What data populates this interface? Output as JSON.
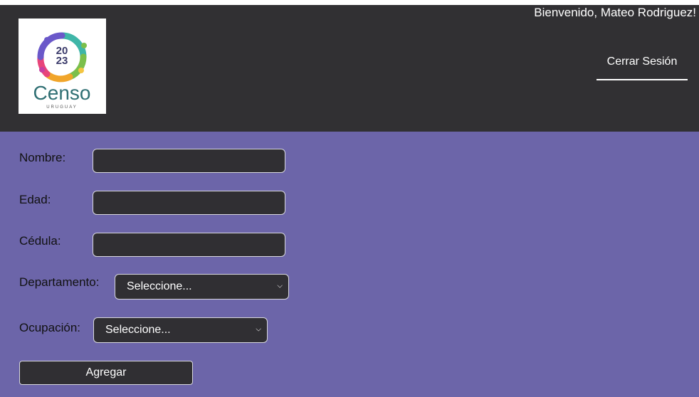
{
  "header": {
    "logo": {
      "year_top": "20",
      "year_bottom": "23",
      "brand": "Censo",
      "country": "URUGUAY"
    },
    "welcome": "Bienvenido, Mateo Rodriguez!",
    "logout_label": "Cerrar Sesión"
  },
  "form": {
    "nombre": {
      "label": "Nombre:",
      "value": ""
    },
    "edad": {
      "label": "Edad:",
      "value": ""
    },
    "cedula": {
      "label": "Cédula:",
      "value": ""
    },
    "departamento": {
      "label": "Departamento:",
      "selected": "Seleccione..."
    },
    "ocupacion": {
      "label": "Ocupación:",
      "selected": "Seleccione..."
    },
    "submit_label": "Agregar"
  },
  "colors": {
    "header_bg": "#313033",
    "main_bg": "#6c65a9",
    "field_bg": "#302f33",
    "brand_text": "#2f6f73"
  },
  "icons": {
    "dropdown": "chevron-down-icon"
  }
}
